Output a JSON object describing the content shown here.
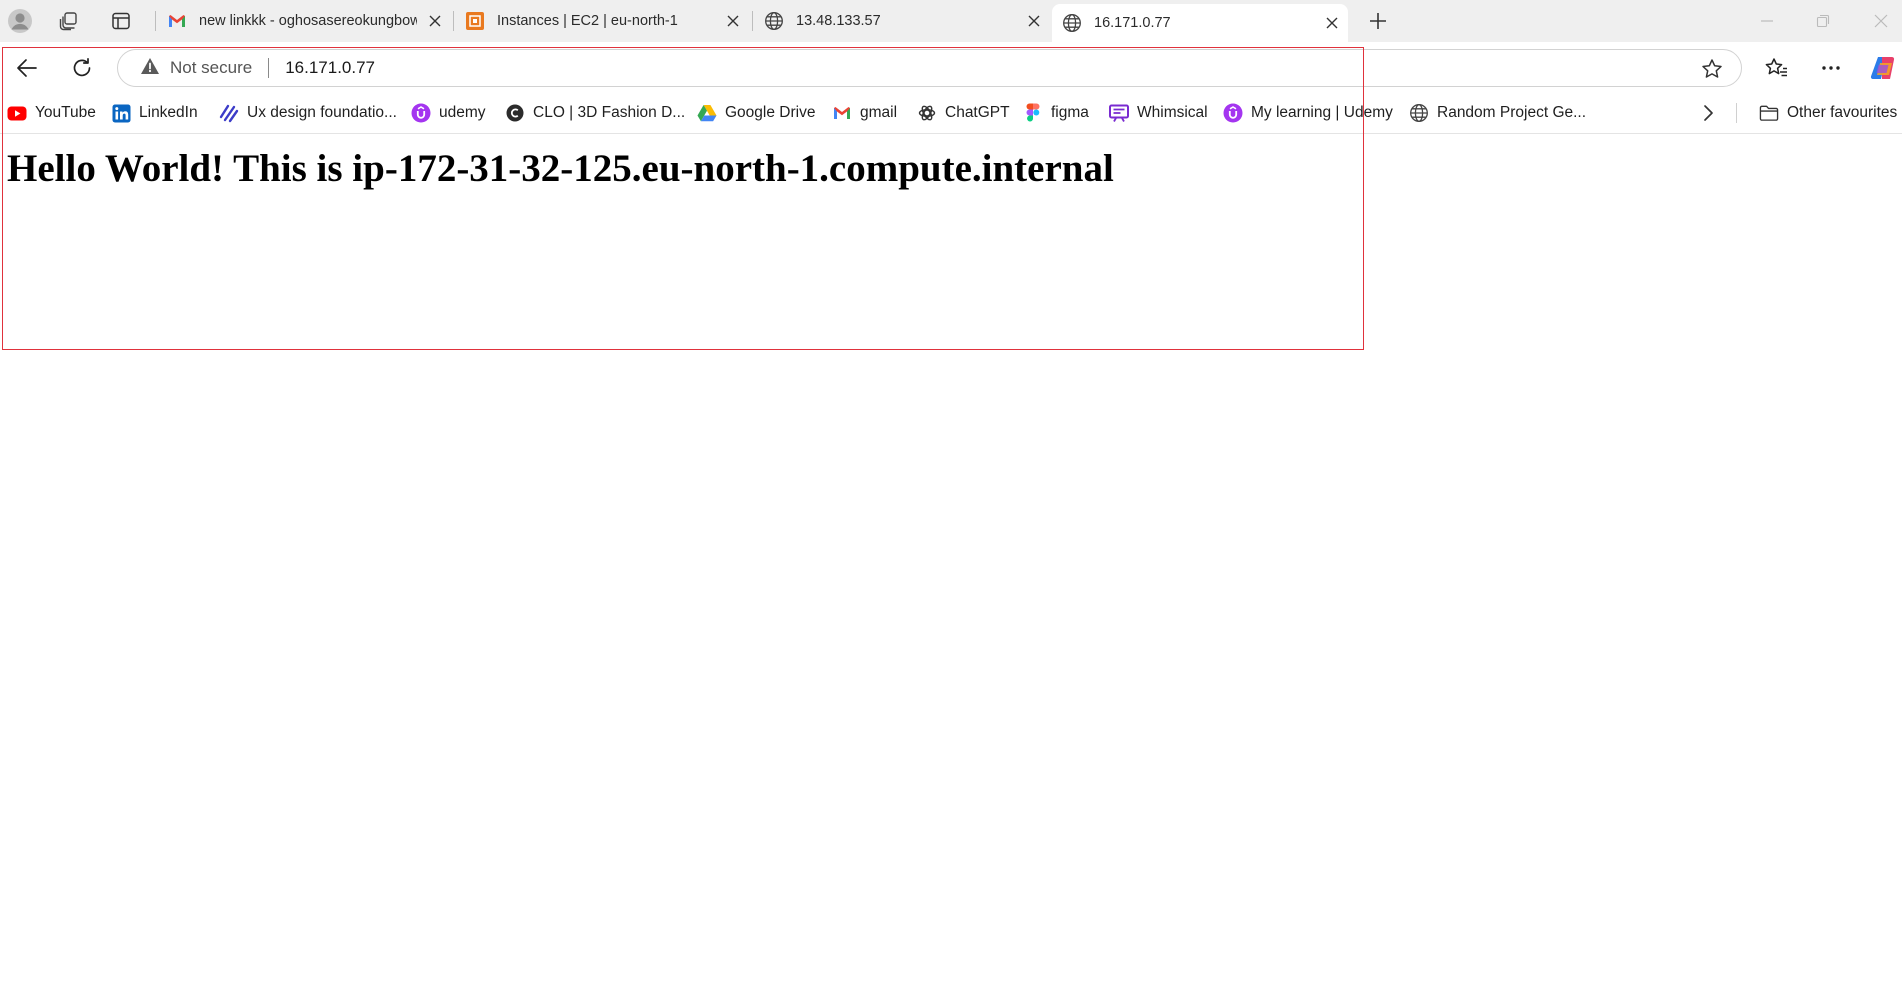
{
  "colors": {
    "tabstrip_bg": "#efefef",
    "accent_highlight_box": "#e0323c",
    "gmail_red": "#ea4335",
    "aws_orange": "#e9791f",
    "youtube_red": "#ff0000",
    "linkedin_blue": "#0a66c2",
    "udemy_purple": "#a435f0",
    "whimsical_purple": "#7a2bd1"
  },
  "tabs": [
    {
      "title": "new linkkk - oghosasereokungbowa",
      "favicon": "gmail-icon",
      "close_icon": "close-icon"
    },
    {
      "title": "Instances | EC2 | eu-north-1",
      "favicon": "aws-ec2-icon",
      "close_icon": "close-icon"
    },
    {
      "title": "13.48.133.57",
      "favicon": "globe-icon",
      "close_icon": "close-icon"
    },
    {
      "title": "16.171.0.77",
      "favicon": "globe-icon",
      "close_icon": "close-icon",
      "active": true
    }
  ],
  "tabstrip_icons": [
    "profile-icon",
    "workspaces-icon",
    "vertical-tabs-icon",
    "new-tab-icon"
  ],
  "window_controls": [
    "minimize-icon",
    "restore-icon",
    "close-window-icon"
  ],
  "toolbar": {
    "security_label": "Not secure",
    "url": "16.171.0.77",
    "icons": [
      "back-icon",
      "reload-icon",
      "warning-icon",
      "favorite-star-icon",
      "favorites-icon",
      "more-icon",
      "copilot-icon"
    ]
  },
  "bookmarks": [
    {
      "label": "YouTube",
      "icon": "youtube-icon"
    },
    {
      "label": "LinkedIn",
      "icon": "linkedin-icon"
    },
    {
      "label": "Ux design foundatio...",
      "icon": "ux-course-icon"
    },
    {
      "label": "udemy",
      "icon": "udemy-icon"
    },
    {
      "label": "CLO | 3D Fashion D...",
      "icon": "clo-icon"
    },
    {
      "label": "Google Drive",
      "icon": "google-drive-icon"
    },
    {
      "label": "gmail",
      "icon": "gmail-icon"
    },
    {
      "label": "ChatGPT",
      "icon": "chatgpt-icon"
    },
    {
      "label": "figma",
      "icon": "figma-icon"
    },
    {
      "label": "Whimsical",
      "icon": "whimsical-icon"
    },
    {
      "label": "My learning | Udemy",
      "icon": "udemy-icon"
    },
    {
      "label": "Random Project Ge...",
      "icon": "globe-icon"
    }
  ],
  "bookmarks_overflow_icon": "chevron-right-icon",
  "other_favourites": {
    "label": "Other favourites",
    "icon": "folder-icon"
  },
  "page": {
    "heading": "Hello World! This is ip-172-31-32-125.eu-north-1.compute.internal"
  }
}
